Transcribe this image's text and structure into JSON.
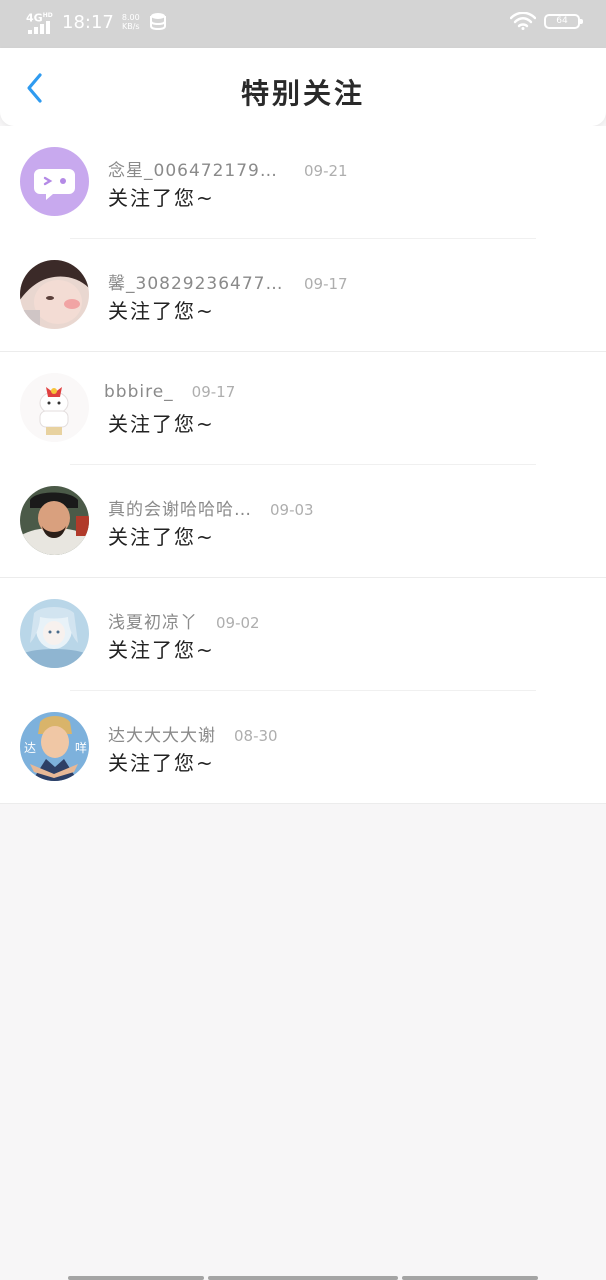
{
  "status_bar": {
    "network": "4G",
    "network_sup": "HD",
    "time": "18:17",
    "speed_value": "8.00",
    "speed_unit": "KB/s",
    "battery": "64"
  },
  "header": {
    "title": "特别关注"
  },
  "notifications": [
    {
      "name": "念星_00647217937…",
      "date": "09-21",
      "message": "关注了您~",
      "avatar": "chat-bubble"
    },
    {
      "name": "馨_308292364775…",
      "date": "09-17",
      "message": "关注了您~",
      "avatar": "photo"
    },
    {
      "name": "bbbire_",
      "date": "09-17",
      "message": "关注了您~",
      "avatar": "photo"
    },
    {
      "name": "真的会谢哈哈哈…",
      "date": "09-03",
      "message": "关注了您~",
      "avatar": "photo"
    },
    {
      "name": "浅夏初凉丫",
      "date": "09-02",
      "message": "关注了您~",
      "avatar": "photo"
    },
    {
      "name": "达大大大大谢",
      "date": "08-30",
      "message": "关注了您~",
      "avatar": "photo",
      "avatar_text_left": "达",
      "avatar_text_right": "咩"
    }
  ],
  "colors": {
    "accent": "#2f9bf0",
    "status_bar": "#d4d4d4",
    "page_bg": "#f7f6f7"
  }
}
